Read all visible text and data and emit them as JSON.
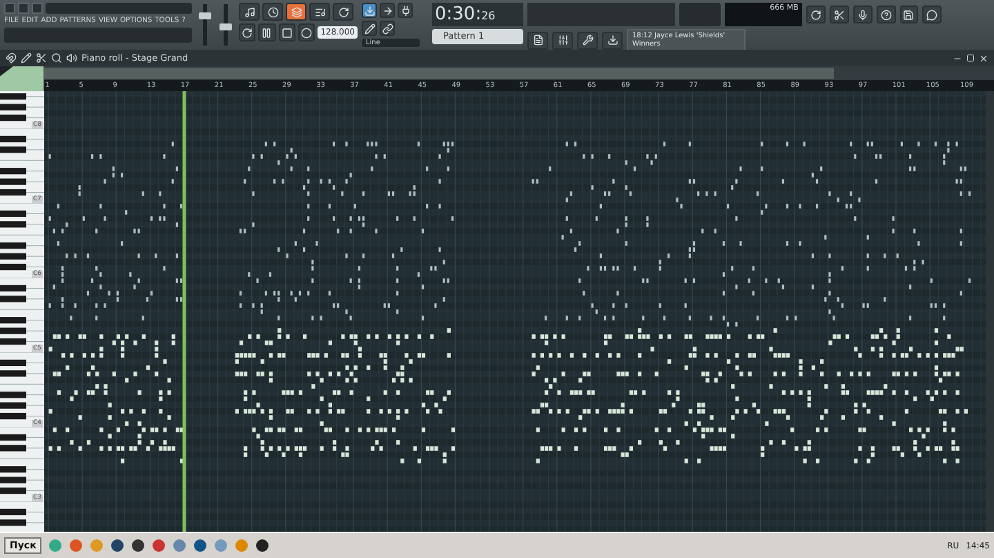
{
  "menu": [
    "FILE",
    "EDIT",
    "ADD",
    "PATTERNS",
    "VIEW",
    "OPTIONS",
    "TOOLS",
    "?"
  ],
  "sliders": [
    {
      "level": 0.75
    },
    {
      "level": 0.45
    }
  ],
  "transport": {
    "tempo": "128.000",
    "snap": "Line",
    "time": "0:30:",
    "time_small": "26",
    "pattern": "Pattern 1"
  },
  "memory": "666 MB",
  "hint": {
    "title": "18:12 Jayce Lewis 'Shields'",
    "subtitle": "Winners"
  },
  "piano_roll": {
    "title": "Piano roll - Stage Grand",
    "ruler": [
      "1",
      "5",
      "9",
      "13",
      "17",
      "21",
      "25",
      "29",
      "33",
      "37",
      "41",
      "45",
      "49",
      "53",
      "57",
      "61",
      "65",
      "69",
      "73",
      "77",
      "81",
      "85",
      "89",
      "93",
      "97",
      "101",
      "105",
      "109"
    ],
    "octaves": [
      "C8",
      "C7",
      "C6",
      "C5",
      "C4",
      "C3"
    ]
  },
  "taskbar": {
    "start": "Пуск",
    "language": "RU",
    "clock": "14:45"
  }
}
